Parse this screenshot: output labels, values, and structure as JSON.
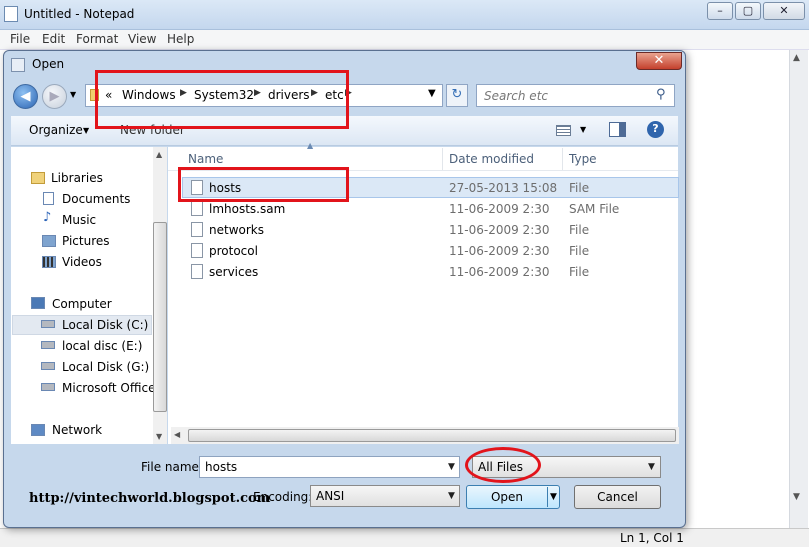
{
  "notepad": {
    "title": "Untitled - Notepad",
    "menu": [
      "File",
      "Edit",
      "Format",
      "View",
      "Help"
    ],
    "status": "Ln 1, Col 1"
  },
  "dialog": {
    "title": "Open",
    "address": {
      "crumbs": [
        "Windows",
        "System32",
        "drivers",
        "etc"
      ],
      "overflow_glyph": "«"
    },
    "search_placeholder": "Search etc",
    "toolbar": {
      "organize": "Organize",
      "new_folder": "New folder"
    },
    "nav": {
      "libraries": "Libraries",
      "library_items": [
        "Documents",
        "Music",
        "Pictures",
        "Videos"
      ],
      "computer": "Computer",
      "drives": [
        "Local Disk (C:)",
        "local disc (E:)",
        "Local Disk (G:)",
        "Microsoft Office"
      ],
      "network": "Network"
    },
    "columns": {
      "name": "Name",
      "date": "Date modified",
      "type": "Type"
    },
    "files": [
      {
        "name": "hosts",
        "date": "27-05-2013 15:08",
        "type": "File"
      },
      {
        "name": "lmhosts.sam",
        "date": "11-06-2009 2:30",
        "type": "SAM File"
      },
      {
        "name": "networks",
        "date": "11-06-2009 2:30",
        "type": "File"
      },
      {
        "name": "protocol",
        "date": "11-06-2009 2:30",
        "type": "File"
      },
      {
        "name": "services",
        "date": "11-06-2009 2:30",
        "type": "File"
      }
    ],
    "file_name_label": "File name:",
    "file_name_value": "hosts",
    "filter": "All Files",
    "encoding_label": "Encoding:",
    "encoding_value": "ANSI",
    "open_label": "Open",
    "cancel_label": "Cancel"
  },
  "watermark": "http://vintechworld.blogspot.com",
  "colors": {
    "highlight": "#e2141b",
    "selection": "#dbe8f6"
  }
}
